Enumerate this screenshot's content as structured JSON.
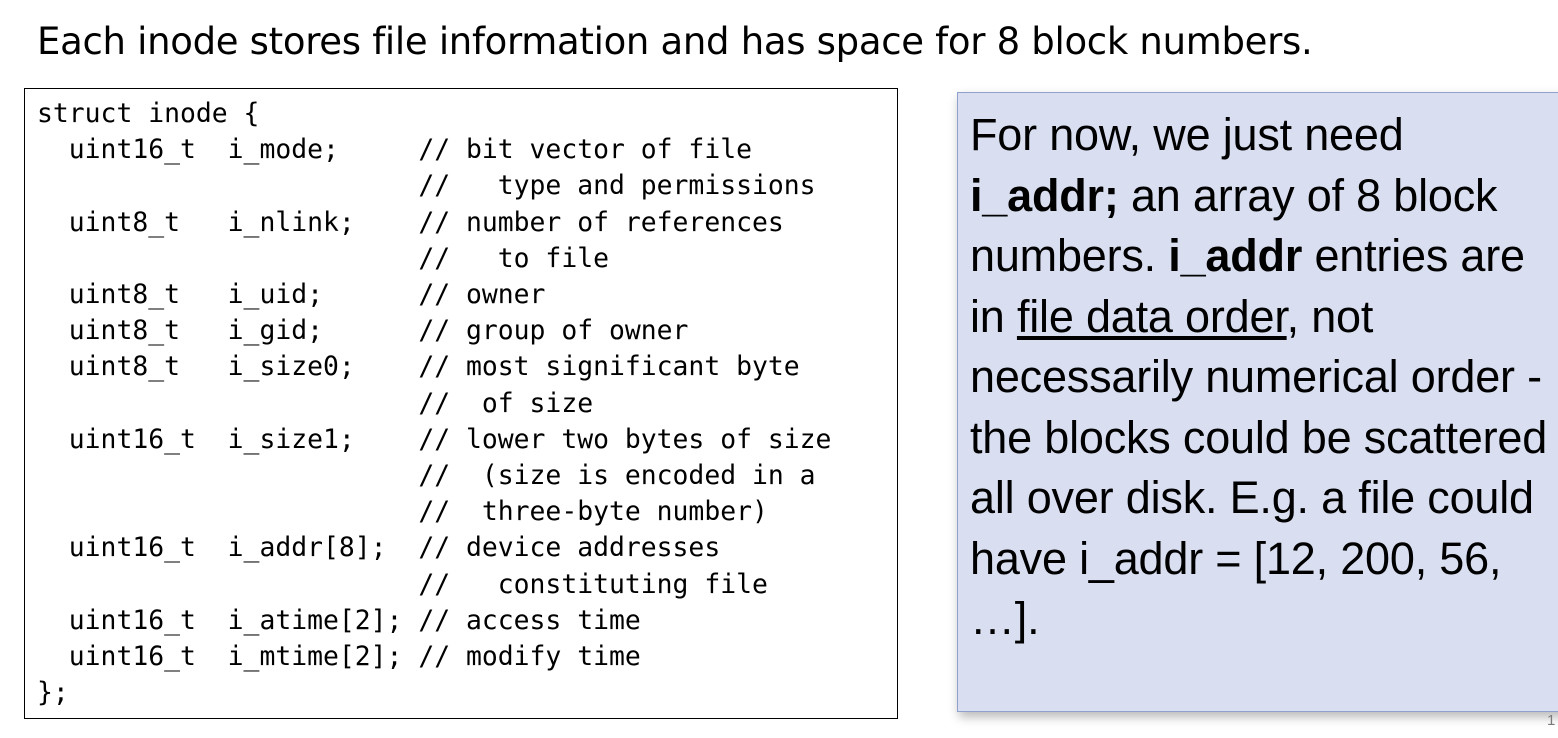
{
  "slide": {
    "title": "Each inode stores file information and has space for 8 block numbers.",
    "page_number": "1"
  },
  "code": {
    "lines": [
      "struct inode {",
      "  uint16_t  i_mode;     // bit vector of file",
      "                        //   type and permissions",
      "  uint8_t   i_nlink;    // number of references",
      "                        //   to file",
      "  uint8_t   i_uid;      // owner",
      "  uint8_t   i_gid;      // group of owner",
      "  uint8_t   i_size0;    // most significant byte",
      "                        //  of size",
      "  uint16_t  i_size1;    // lower two bytes of size",
      "                        //  (size is encoded in a",
      "                        //  three-byte number)",
      "  uint16_t  i_addr[8];  // device addresses",
      "                        //   constituting file",
      "  uint16_t  i_atime[2]; // access time",
      "  uint16_t  i_mtime[2]; // modify time",
      "};"
    ]
  },
  "note": {
    "part1": "For now, we just need ",
    "bold1": "i_addr;",
    "part2": " an array of 8 block numbers. ",
    "bold2": "i_addr",
    "part3": " entries are in ",
    "underline1": "file data order",
    "part4": ", not necessarily numerical order - the blocks could be scattered all over disk.  E.g. a file could have i_addr = [12, 200, 56, …].",
    "background_color": "#d9dff0",
    "border_color": "#8fa1cc"
  }
}
